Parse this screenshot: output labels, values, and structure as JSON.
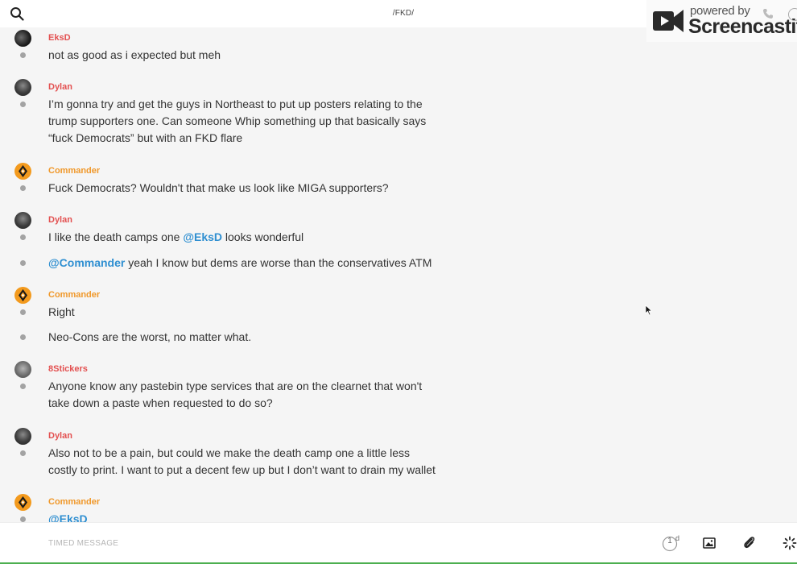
{
  "header": {
    "channel": "/FKD/",
    "watermark_small": "powered by",
    "watermark_big": "Screencastify"
  },
  "messages": [
    {
      "author": "EksD",
      "lines": [
        "not as good as i expected but meh"
      ]
    },
    {
      "author": "Dylan",
      "lines": [
        "I’m gonna try and get the guys in Northeast to put up posters relating to the",
        "trump supporters one. Can someone Whip something up that basically says",
        "“fuck Democrats” but with an FKD flare"
      ]
    },
    {
      "author": "Commander",
      "lines": [
        "Fuck Democrats? Wouldn't that make us look like MIGA supporters?"
      ]
    },
    {
      "author": "Dylan",
      "line1_pre": "I like the death camps one ",
      "line1_mention": "@EksD",
      "line1_post": " looks wonderful",
      "line2_mention": "@Commander",
      "line2_post": " yeah I know but dems are worse than the conservatives ATM"
    },
    {
      "author": "Commander",
      "lines": [
        "Right",
        "Neo-Cons are the worst, no matter what."
      ]
    },
    {
      "author": "8Stickers",
      "lines": [
        "Anyone know any pastebin type services that are on the clearnet that won't",
        "take down a paste when requested to do so?"
      ]
    },
    {
      "author": "Dylan",
      "lines": [
        "Also not to be a pain, but could we make the death camp one a little less",
        "costly to print. I want to put a decent few up but I don’t want to drain my wallet"
      ]
    },
    {
      "author": "Commander",
      "mention": "@EksD"
    }
  ],
  "composer": {
    "placeholder": "TIMED MESSAGE",
    "timer_value": "1",
    "timer_unit": "d"
  },
  "colors": {
    "author_red": "#e35050",
    "author_orange": "#f0982a",
    "mention": "#2f8fd1",
    "background": "#f5f5f5"
  },
  "icons": [
    "search-icon",
    "phone-icon",
    "info-icon",
    "timer-icon",
    "image-icon",
    "paperclip-icon",
    "spinner-icon",
    "mouse-cursor-icon"
  ]
}
